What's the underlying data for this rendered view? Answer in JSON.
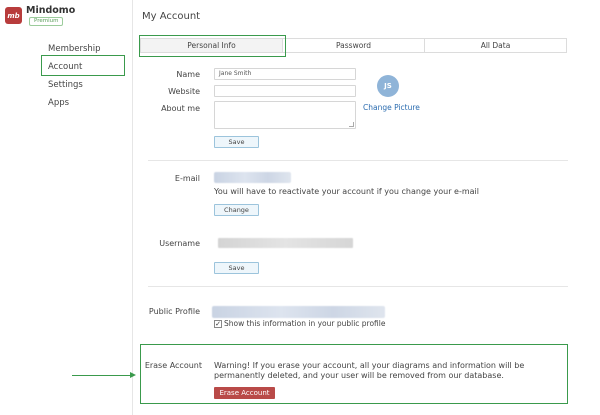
{
  "brand": {
    "logo_text": "mb",
    "name": "Mindomo",
    "badge": "Premium"
  },
  "sidebar": {
    "items": [
      "Membership",
      "Account",
      "Settings",
      "Apps"
    ]
  },
  "page_title": "My Account",
  "tabs": [
    "Personal Info",
    "Password",
    "All Data"
  ],
  "form": {
    "name_label": "Name",
    "name_value": "Jane Smith",
    "website_label": "Website",
    "website_value": "",
    "about_label": "About me",
    "save_label": "Save",
    "avatar_initials": "JS",
    "change_picture": "Change Picture"
  },
  "email": {
    "label": "E-mail",
    "note": "You will have to reactivate your account if you change your e-mail",
    "change_label": "Change"
  },
  "username": {
    "label": "Username",
    "save_label": "Save"
  },
  "public_profile": {
    "label": "Public Profile",
    "checkbox_label": "Show this information in your public profile",
    "checked": true
  },
  "erase": {
    "label": "Erase Account",
    "warning": "Warning! If you erase your account, all your diagrams and information will be permanently deleted, and your user will be removed from our database.",
    "button_label": "Erase Account"
  },
  "colors": {
    "highlight": "#3a9a4c",
    "brand": "#b83c3c",
    "link": "#2b6cb0",
    "danger": "#b94a48"
  }
}
